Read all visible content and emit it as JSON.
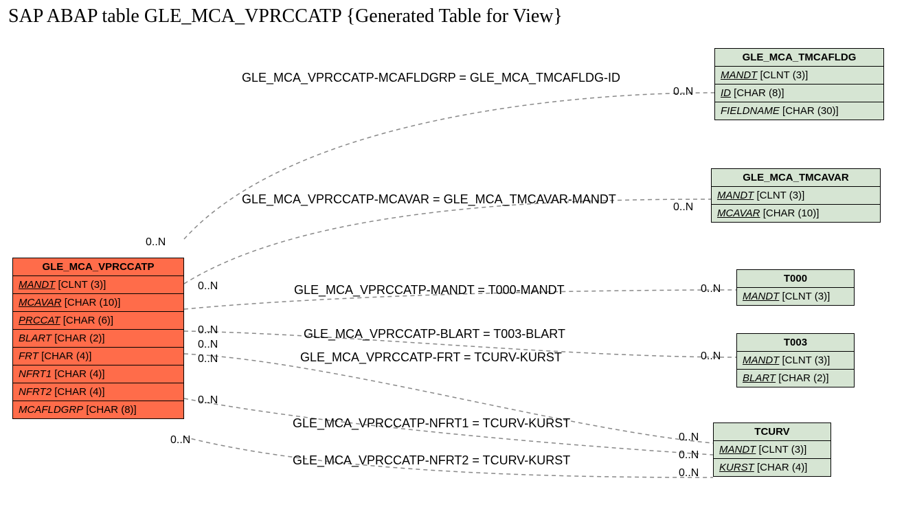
{
  "title": "SAP ABAP table GLE_MCA_VPRCCATP {Generated Table for View}",
  "main_entity": {
    "name": "GLE_MCA_VPRCCATP",
    "fields": [
      {
        "label": "MANDT",
        "type": "[CLNT (3)]",
        "style": "key"
      },
      {
        "label": "MCAVAR",
        "type": "[CHAR (10)]",
        "style": "key"
      },
      {
        "label": "PRCCAT",
        "type": "[CHAR (6)]",
        "style": "key"
      },
      {
        "label": "BLART",
        "type": "[CHAR (2)]",
        "style": "fk"
      },
      {
        "label": "FRT",
        "type": "[CHAR (4)]",
        "style": "fk"
      },
      {
        "label": "NFRT1",
        "type": "[CHAR (4)]",
        "style": "fk"
      },
      {
        "label": "NFRT2",
        "type": "[CHAR (4)]",
        "style": "fk"
      },
      {
        "label": "MCAFLDGRP",
        "type": "[CHAR (8)]",
        "style": "fk"
      }
    ]
  },
  "ref_entities": [
    {
      "name": "GLE_MCA_TMCAFLDG",
      "fields": [
        {
          "label": "MANDT",
          "type": "[CLNT (3)]",
          "style": "key"
        },
        {
          "label": "ID",
          "type": "[CHAR (8)]",
          "style": "key"
        },
        {
          "label": "FIELDNAME",
          "type": "[CHAR (30)]",
          "style": "fk"
        }
      ]
    },
    {
      "name": "GLE_MCA_TMCAVAR",
      "fields": [
        {
          "label": "MANDT",
          "type": "[CLNT (3)]",
          "style": "key"
        },
        {
          "label": "MCAVAR",
          "type": "[CHAR (10)]",
          "style": "key"
        }
      ]
    },
    {
      "name": "T000",
      "fields": [
        {
          "label": "MANDT",
          "type": "[CLNT (3)]",
          "style": "key"
        }
      ]
    },
    {
      "name": "T003",
      "fields": [
        {
          "label": "MANDT",
          "type": "[CLNT (3)]",
          "style": "key"
        },
        {
          "label": "BLART",
          "type": "[CHAR (2)]",
          "style": "key"
        }
      ]
    },
    {
      "name": "TCURV",
      "fields": [
        {
          "label": "MANDT",
          "type": "[CLNT (3)]",
          "style": "key"
        },
        {
          "label": "KURST",
          "type": "[CHAR (4)]",
          "style": "key"
        }
      ]
    }
  ],
  "relations": [
    {
      "label": "GLE_MCA_VPRCCATP-MCAFLDGRP = GLE_MCA_TMCAFLDG-ID"
    },
    {
      "label": "GLE_MCA_VPRCCATP-MCAVAR = GLE_MCA_TMCAVAR-MANDT"
    },
    {
      "label": "GLE_MCA_VPRCCATP-MANDT = T000-MANDT"
    },
    {
      "label": "GLE_MCA_VPRCCATP-BLART = T003-BLART"
    },
    {
      "label": "GLE_MCA_VPRCCATP-FRT = TCURV-KURST"
    },
    {
      "label": "GLE_MCA_VPRCCATP-NFRT1 = TCURV-KURST"
    },
    {
      "label": "GLE_MCA_VPRCCATP-NFRT2 = TCURV-KURST"
    }
  ],
  "cardinality": "0..N"
}
